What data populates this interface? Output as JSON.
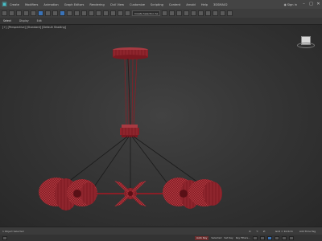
{
  "menubar": {
    "items": [
      "Create",
      "Modifiers",
      "Animation",
      "Graph Editors",
      "Rendering",
      "Civil View",
      "Customize",
      "Scripting",
      "Content",
      "Arnold",
      "Help",
      "3DSMAX2"
    ],
    "signin": "Sign in"
  },
  "toolbar": {
    "selection_set": "Create Selection Se"
  },
  "ribbon": {
    "tabs": [
      "Select",
      "Display",
      "Edit"
    ]
  },
  "viewport": {
    "label": "[+] [Perspective] [Standard] [Default Shading]"
  },
  "status": {
    "message": "1 Object Selected",
    "x": "X:",
    "y": "Y:",
    "z": "Z:",
    "grid": "Grid = 10.0cm",
    "add_time_tag": "Add Time Tag",
    "auto_key": "Auto Key",
    "selected": "Selected",
    "set_key": "Set Key",
    "key_filters": "Key Filters..."
  },
  "colors": {
    "model": "#8a1e26",
    "model_light": "#b53a40",
    "wire": "#1a1a1a"
  }
}
